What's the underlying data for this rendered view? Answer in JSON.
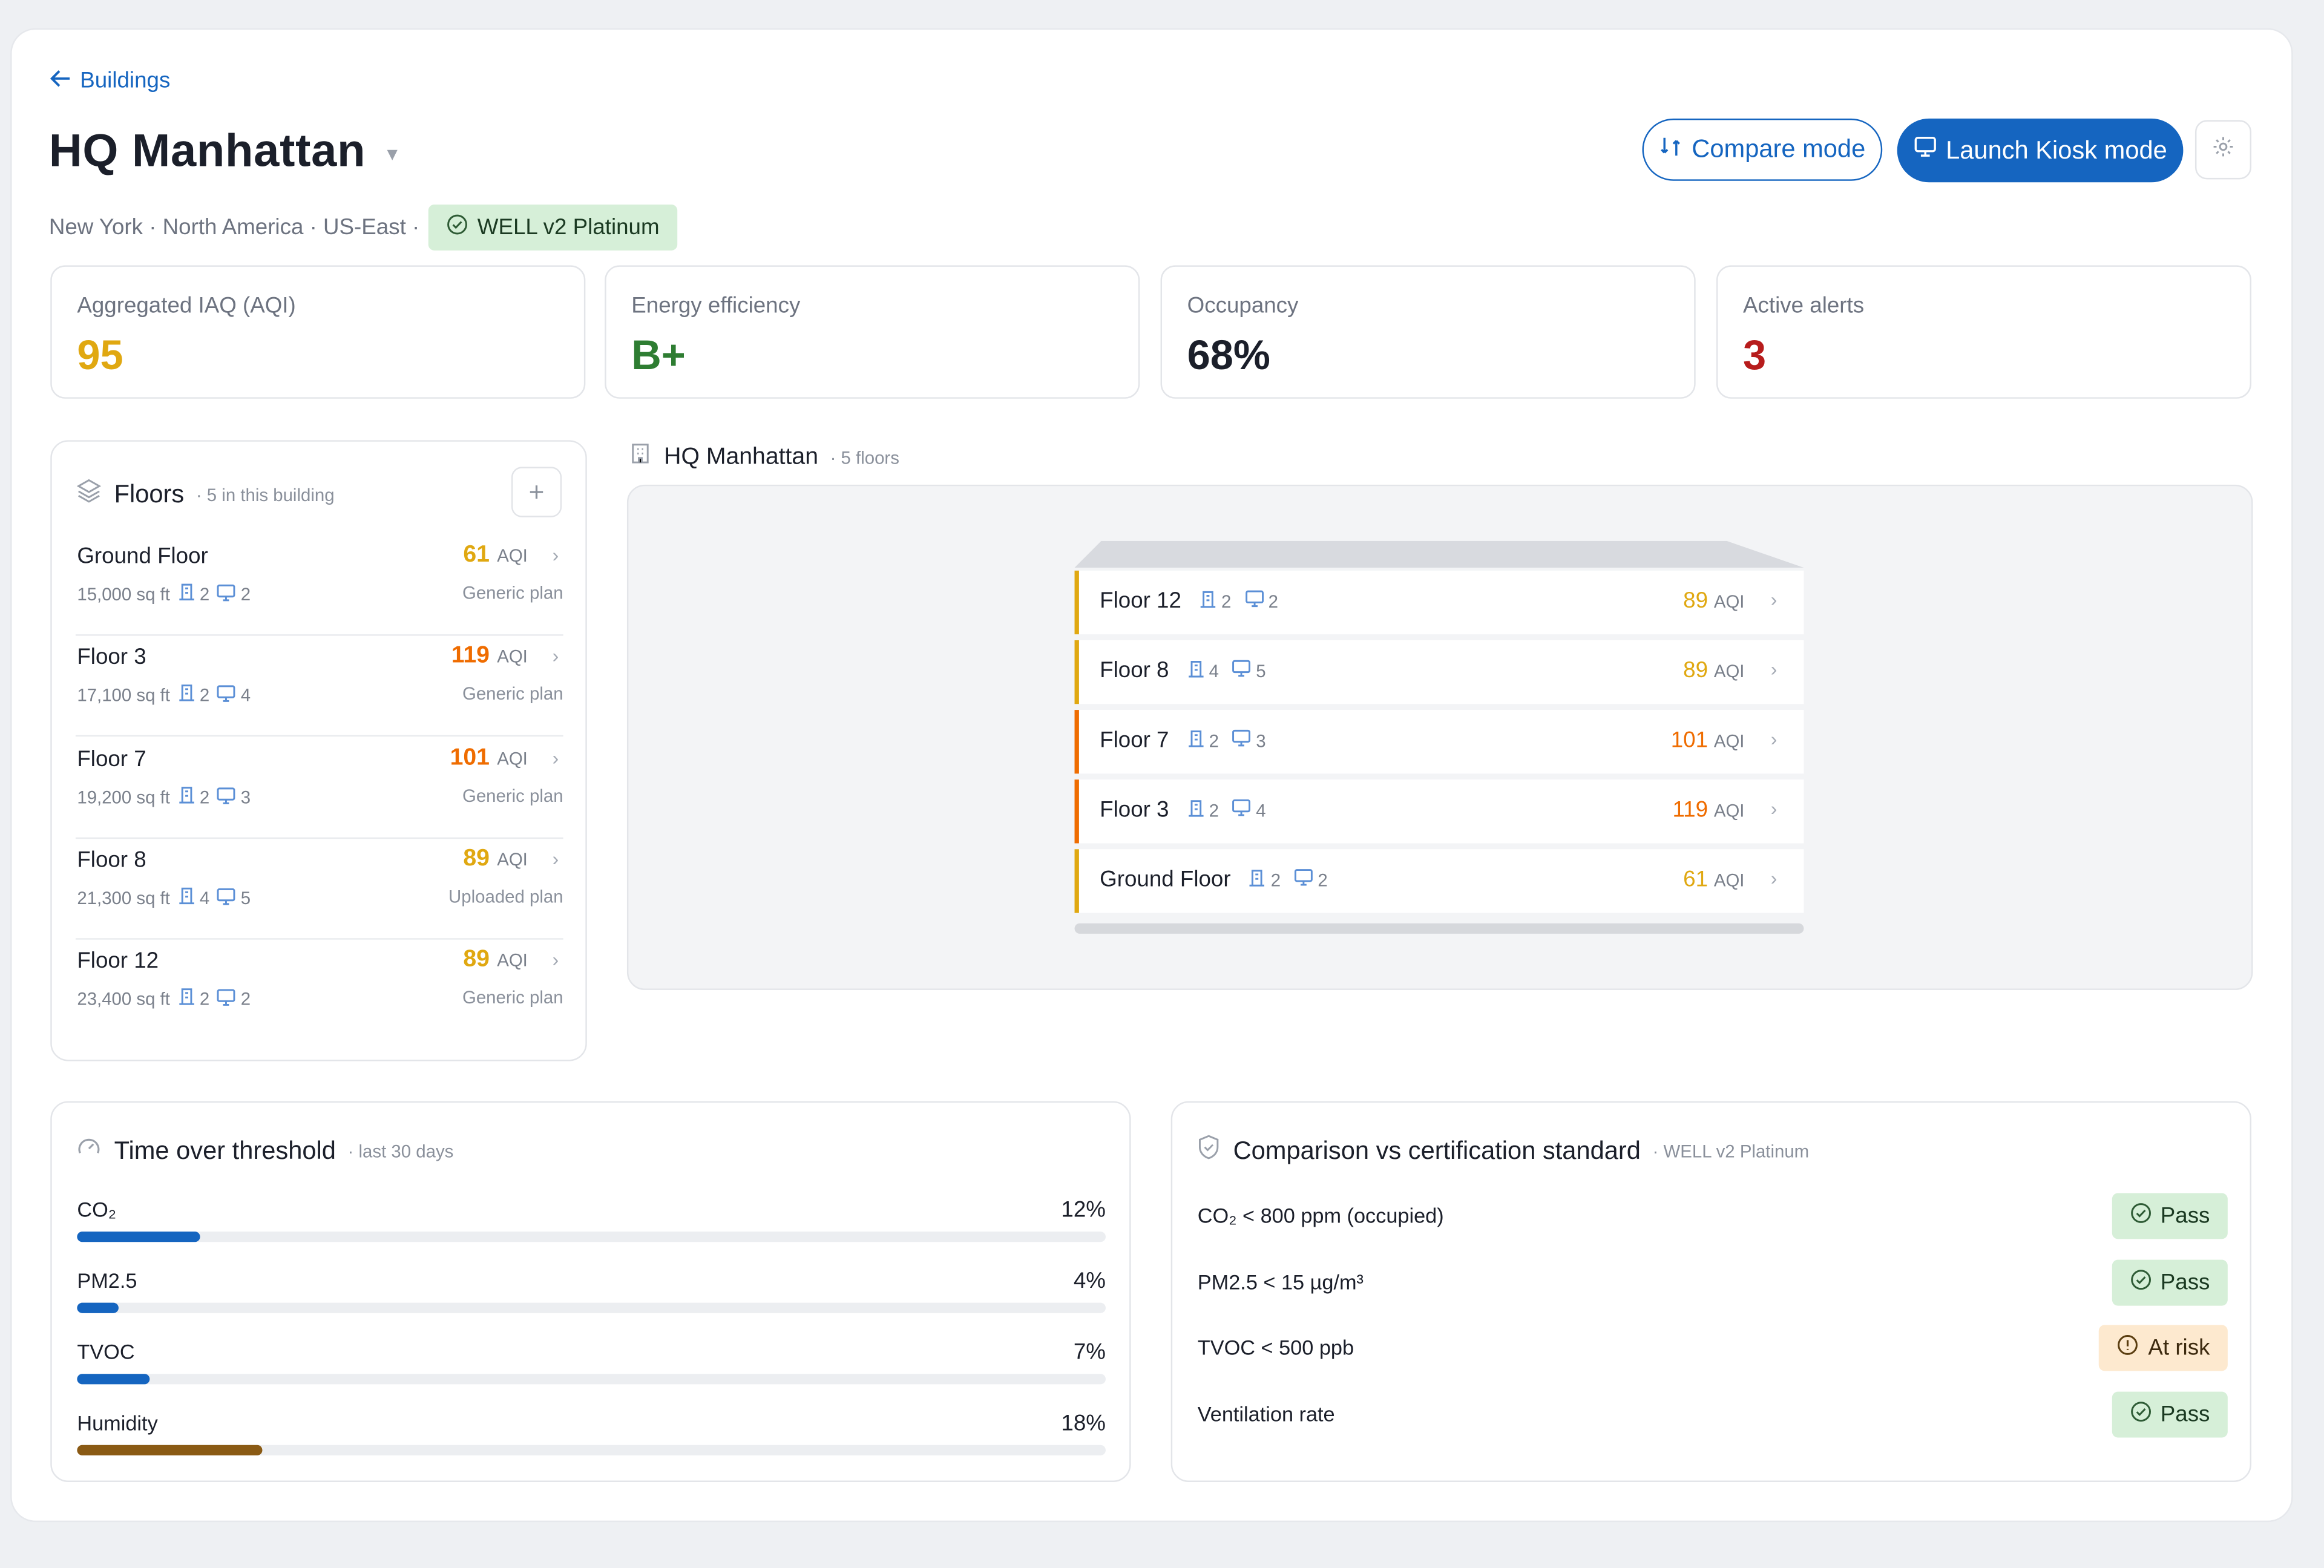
{
  "nav": {
    "back_label": "Buildings"
  },
  "building": {
    "name": "HQ Manhattan",
    "location": "New York · North America · US-East ·",
    "certification": "WELL v2 Platinum"
  },
  "actions": {
    "compare_label": "Compare mode",
    "kiosk_label": "Launch Kiosk mode"
  },
  "kpis": [
    {
      "label": "Aggregated IAQ (AQI)",
      "value": "95",
      "color": "#e0a811"
    },
    {
      "label": "Energy efficiency",
      "value": "B+",
      "color": "#2e7d32"
    },
    {
      "label": "Occupancy",
      "value": "68%",
      "color": "#1b1f2a"
    },
    {
      "label": "Active alerts",
      "value": "3",
      "color": "#b71c1c"
    }
  ],
  "floors_panel": {
    "title": "Floors",
    "subtitle": "· 5 in this building",
    "aqi_unit": "AQI",
    "items": [
      {
        "name": "Ground Floor",
        "area": "15,000 sq ft",
        "sensors": "2",
        "devices": "2",
        "aqi": "61",
        "aqi_color": "#e0a811",
        "plan": "Generic plan"
      },
      {
        "name": "Floor 3",
        "area": "17,100 sq ft",
        "sensors": "2",
        "devices": "4",
        "aqi": "119",
        "aqi_color": "#ef6c00",
        "plan": "Generic plan"
      },
      {
        "name": "Floor 7",
        "area": "19,200 sq ft",
        "sensors": "2",
        "devices": "3",
        "aqi": "101",
        "aqi_color": "#ef6c00",
        "plan": "Generic plan"
      },
      {
        "name": "Floor 8",
        "area": "21,300 sq ft",
        "sensors": "4",
        "devices": "5",
        "aqi": "89",
        "aqi_color": "#e0a811",
        "plan": "Uploaded plan"
      },
      {
        "name": "Floor 12",
        "area": "23,400 sq ft",
        "sensors": "2",
        "devices": "2",
        "aqi": "89",
        "aqi_color": "#e0a811",
        "plan": "Generic plan"
      }
    ]
  },
  "building_view": {
    "title": "HQ Manhattan",
    "subtitle": "· 5 floors",
    "stack": [
      {
        "name": "Floor 12",
        "sensors": "2",
        "devices": "2",
        "aqi": "89",
        "aqi_color": "#e0a811"
      },
      {
        "name": "Floor 8",
        "sensors": "4",
        "devices": "5",
        "aqi": "89",
        "aqi_color": "#e0a811"
      },
      {
        "name": "Floor 7",
        "sensors": "2",
        "devices": "3",
        "aqi": "101",
        "aqi_color": "#ef6c00"
      },
      {
        "name": "Floor 3",
        "sensors": "2",
        "devices": "4",
        "aqi": "119",
        "aqi_color": "#ef6c00"
      },
      {
        "name": "Ground Floor",
        "sensors": "2",
        "devices": "2",
        "aqi": "61",
        "aqi_color": "#e0a811"
      }
    ]
  },
  "threshold": {
    "title": "Time over threshold",
    "subtitle": "· last 30 days",
    "metrics": [
      {
        "name": "CO₂",
        "value": "12%",
        "fraction": 0.12,
        "color": "#1565c0"
      },
      {
        "name": "PM2.5",
        "value": "4%",
        "fraction": 0.04,
        "color": "#1565c0"
      },
      {
        "name": "TVOC",
        "value": "7%",
        "fraction": 0.07,
        "color": "#1565c0"
      },
      {
        "name": "Humidity",
        "value": "18%",
        "fraction": 0.18,
        "color": "#8a5a14"
      }
    ]
  },
  "certification_comparison": {
    "title": "Comparison vs certification standard",
    "subtitle": "· WELL v2 Platinum",
    "criteria": [
      {
        "name": "CO₂ < 800 ppm (occupied)",
        "status": "Pass",
        "kind": "pass"
      },
      {
        "name": "PM2.5 < 15 µg/m³",
        "status": "Pass",
        "kind": "pass"
      },
      {
        "name": "TVOC < 500 ppb",
        "status": "At risk",
        "kind": "risk"
      },
      {
        "name": "Ventilation rate",
        "status": "Pass",
        "kind": "pass"
      }
    ]
  }
}
